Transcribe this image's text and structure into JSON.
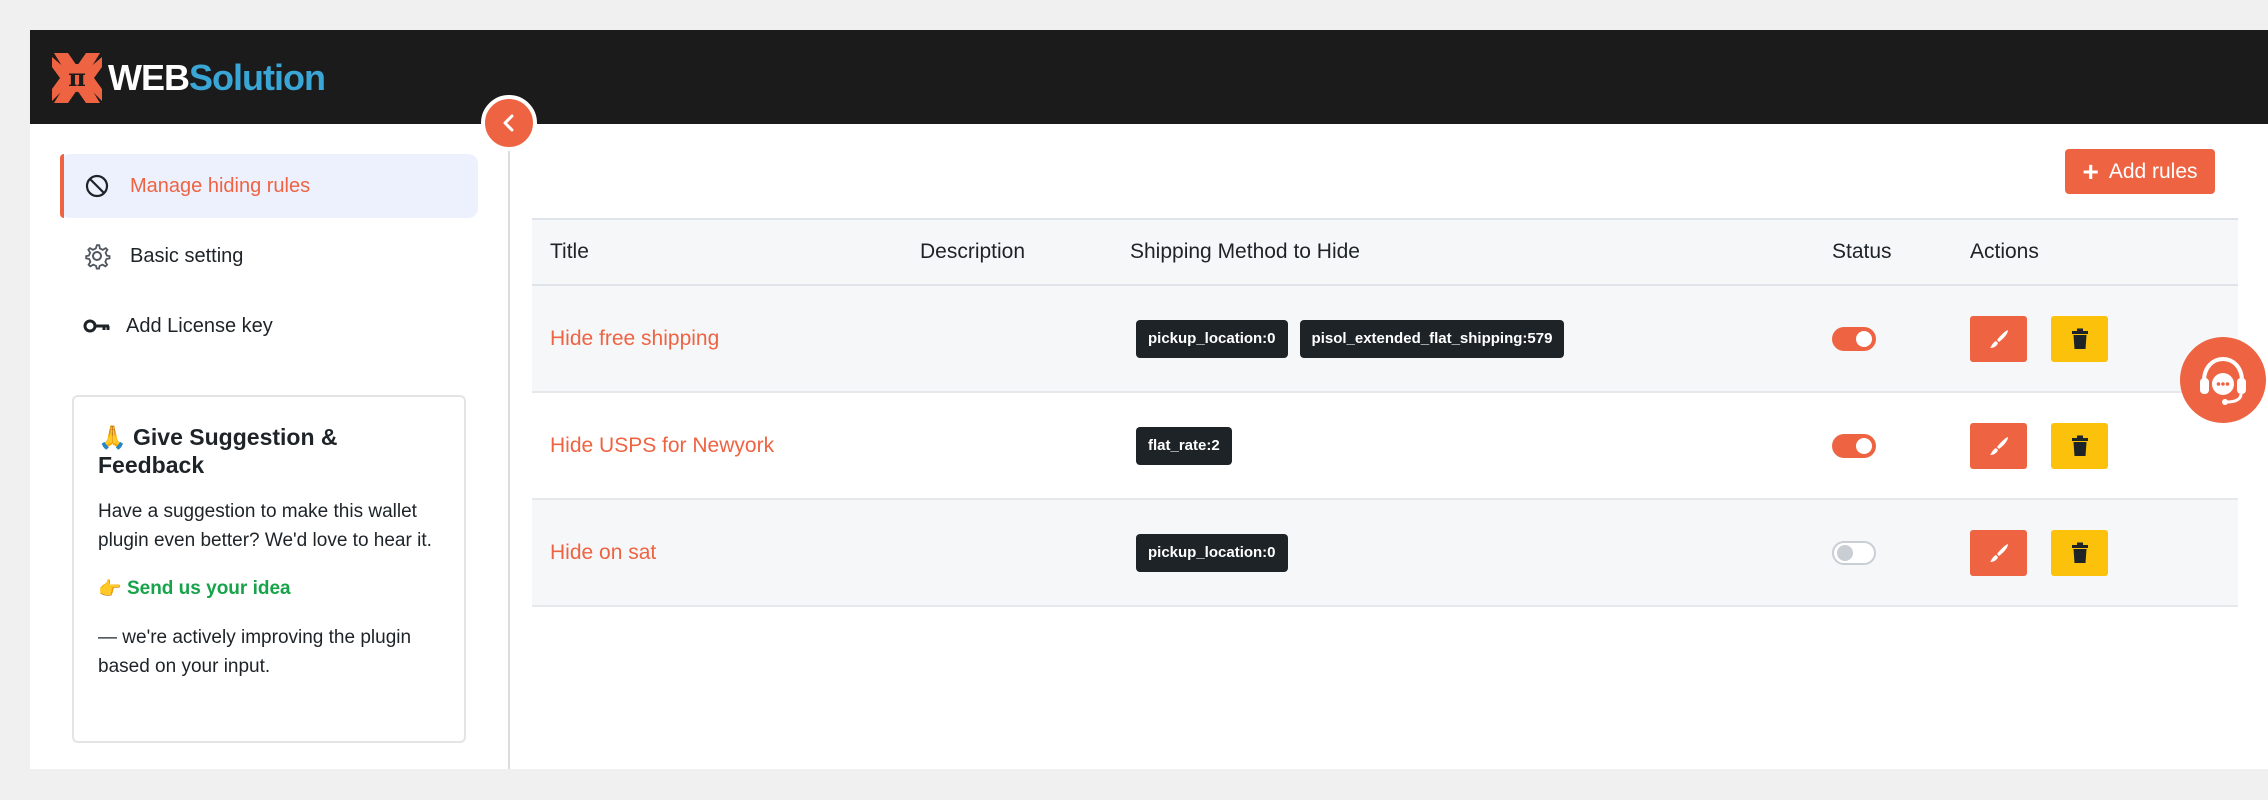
{
  "brand": {
    "web": "WEB",
    "solution": "Solution",
    "logo_icon": "pi-logo-icon",
    "accent": "#ee6443",
    "accent2": "#3aa6d6"
  },
  "sidebar": {
    "collapse_icon": "chevron-left-icon",
    "items": [
      {
        "label": "Manage hiding rules",
        "icon": "ban-icon",
        "active": true
      },
      {
        "label": "Basic setting",
        "icon": "gear-icon",
        "active": false
      },
      {
        "label": "Add License key",
        "icon": "key-icon",
        "active": false
      }
    ],
    "suggestion": {
      "emoji": "🙏",
      "title": "Give Suggestion & Feedback",
      "body": "Have a suggestion to make this wallet plugin even better? We'd love to hear it.",
      "link_emoji": "👉",
      "link_label": "Send us your idea",
      "footer": "— we're actively improving the plugin based on your input."
    }
  },
  "toolbar": {
    "add_label": "Add rules",
    "add_icon": "plus-icon"
  },
  "table": {
    "headers": {
      "title": "Title",
      "description": "Description",
      "shipping": "Shipping Method to Hide",
      "status": "Status",
      "actions": "Actions"
    },
    "rows": [
      {
        "title": "Hide free shipping",
        "description": "",
        "methods": [
          "pickup_location:0",
          "pisol_extended_flat_shipping:579"
        ],
        "enabled": true
      },
      {
        "title": "Hide USPS for Newyork",
        "description": "",
        "methods": [
          "flat_rate:2"
        ],
        "enabled": true
      },
      {
        "title": "Hide on sat",
        "description": "",
        "methods": [
          "pickup_location:0"
        ],
        "enabled": false
      }
    ]
  },
  "support_icon": "headset-chat-icon"
}
